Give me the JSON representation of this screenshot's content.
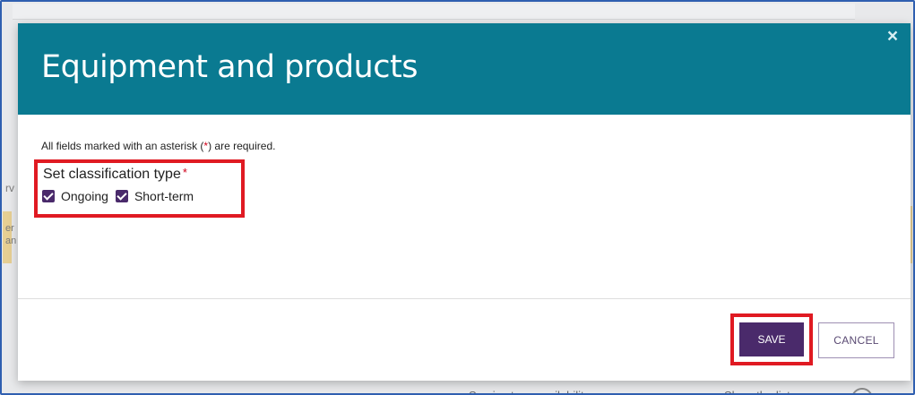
{
  "modal": {
    "title": "Equipment and products",
    "close_symbol": "×",
    "required_note_prefix": "All fields marked with an asterisk (",
    "required_note_star": "*",
    "required_note_suffix": ") are required.",
    "classification": {
      "label": "Set classification type",
      "required_star": "*",
      "options": [
        {
          "label": "Ongoing",
          "checked": true
        },
        {
          "label": "Short-term",
          "checked": true
        }
      ]
    },
    "buttons": {
      "save": "SAVE",
      "cancel": "CANCEL"
    }
  },
  "background": {
    "fragment_1": "rv",
    "fragment_2a": "er",
    "fragment_2b": "an",
    "bottom_text": "Service type availability",
    "bottom_text_2": "Show the list"
  },
  "colors": {
    "header_bg": "#0a7a91",
    "primary_button": "#4a2a6b",
    "highlight_border": "#e01a22"
  }
}
